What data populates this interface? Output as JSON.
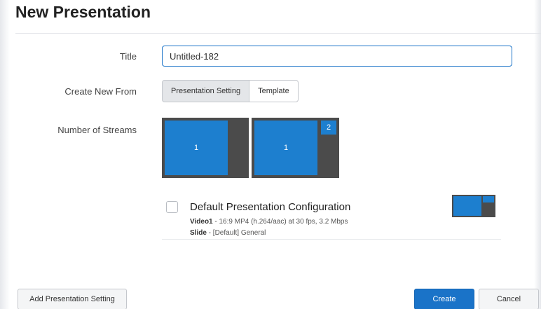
{
  "dialog": {
    "title": "New Presentation"
  },
  "form": {
    "title_label": "Title",
    "title_value": "Untitled-182",
    "create_from_label": "Create New From",
    "create_from_options": [
      "Presentation Setting",
      "Template"
    ],
    "create_from_selected": "Presentation Setting",
    "streams_label": "Number of Streams"
  },
  "stream_layouts": [
    {
      "streams": 1,
      "main_label": "1"
    },
    {
      "streams": 2,
      "main_label": "1",
      "secondary_label": "2"
    }
  ],
  "configs": [
    {
      "name": "Default Presentation Configuration",
      "video_label": "Video1",
      "video_detail": " - 16:9 MP4 (h.264/aac) at 30 fps, 3.2 Mbps",
      "slide_label": "Slide",
      "slide_detail": " - [Default] General",
      "checked": false
    }
  ],
  "footer": {
    "add_setting_label": "Add Presentation Setting",
    "create_label": "Create",
    "cancel_label": "Cancel"
  },
  "colors": {
    "accent": "#1a73c8",
    "stream_blue": "#1d7fcf",
    "thumb_bg": "#4b4b4b"
  }
}
